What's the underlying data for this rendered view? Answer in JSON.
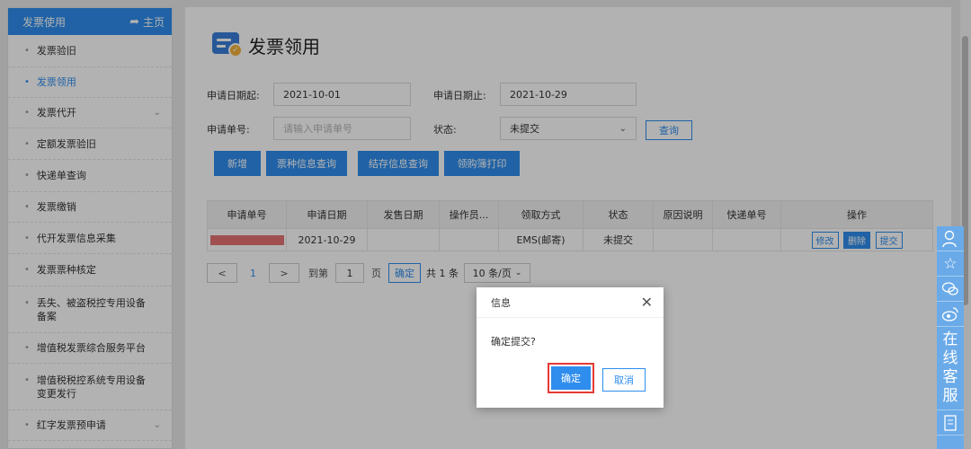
{
  "sidebar": {
    "title": "发票使用",
    "home": "主页",
    "items": [
      {
        "label": "发票验旧",
        "active": false,
        "expandable": false
      },
      {
        "label": "发票领用",
        "active": true,
        "expandable": false
      },
      {
        "label": "发票代开",
        "active": false,
        "expandable": true
      },
      {
        "label": "定额发票验旧",
        "active": false,
        "expandable": false
      },
      {
        "label": "快递单查询",
        "active": false,
        "expandable": false
      },
      {
        "label": "发票缴销",
        "active": false,
        "expandable": false
      },
      {
        "label": "代开发票信息采集",
        "active": false,
        "expandable": false
      },
      {
        "label": "发票票种核定",
        "active": false,
        "expandable": false
      },
      {
        "label": "丢失、被盗税控专用设备备案",
        "active": false,
        "expandable": false
      },
      {
        "label": "增值税发票综合服务平台",
        "active": false,
        "expandable": false
      },
      {
        "label": "增值税税控系统专用设备变更发行",
        "active": false,
        "expandable": false
      },
      {
        "label": "红字发票预申请",
        "active": false,
        "expandable": true
      }
    ]
  },
  "page": {
    "title": "发票领用"
  },
  "form": {
    "start_label": "申请日期起:",
    "start_value": "2021-10-01",
    "end_label": "申请日期止:",
    "end_value": "2021-10-29",
    "no_label": "申请单号:",
    "no_placeholder": "请输入申请单号",
    "status_label": "状态:",
    "status_value": "未提交",
    "query_button": "查询"
  },
  "toolbar": {
    "add": "新增",
    "ticket_query": "票种信息查询",
    "stock_query": "结存信息查询",
    "print": "领购簿打印"
  },
  "table": {
    "headers": [
      "申请单号",
      "申请日期",
      "发售日期",
      "操作员...",
      "领取方式",
      "状态",
      "原因说明",
      "快递单号",
      "操作"
    ],
    "row": {
      "date": "2021-10-29",
      "method": "EMS(邮寄)",
      "status": "未提交",
      "ops": [
        "修改",
        "删除",
        "提交"
      ]
    }
  },
  "pager": {
    "prev": "<",
    "page": "1",
    "next": ">",
    "goto_label": "到第",
    "goto_value": "1",
    "page_unit": "页",
    "confirm": "确定",
    "total": "共 1 条",
    "page_size": "10 条/页"
  },
  "dialog": {
    "title": "信息",
    "message": "确定提交?",
    "ok": "确定",
    "cancel": "取消"
  },
  "service": {
    "text_chars": [
      "在",
      "线",
      "客",
      "服"
    ]
  },
  "colors": {
    "primary": "#2e8ded",
    "highlight": "#e53935"
  }
}
